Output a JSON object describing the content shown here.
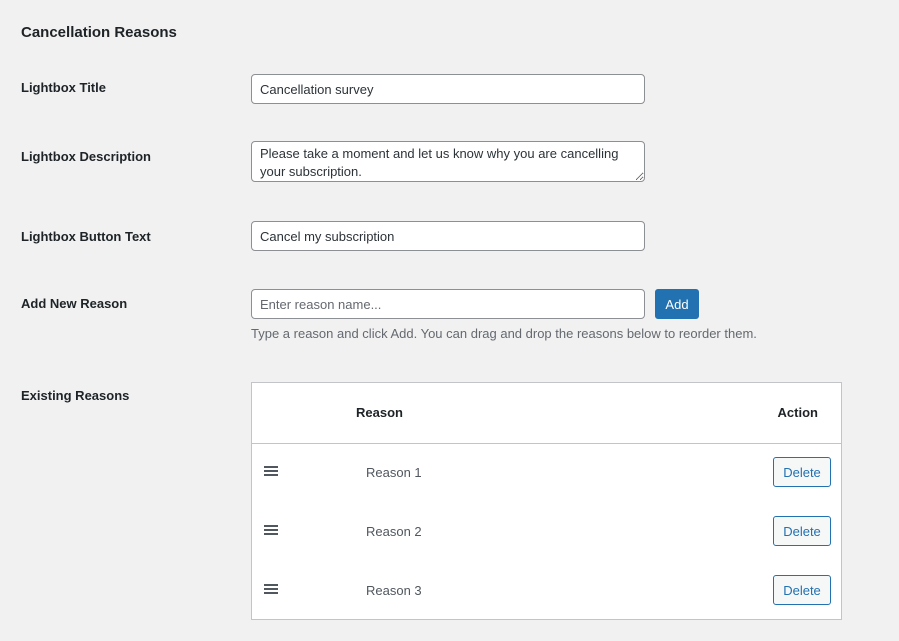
{
  "section": {
    "title": "Cancellation Reasons"
  },
  "fields": {
    "lightbox_title": {
      "label": "Lightbox Title",
      "value": "Cancellation survey"
    },
    "lightbox_description": {
      "label": "Lightbox Description",
      "value": "Please take a moment and let us know why you are cancelling your subscription."
    },
    "lightbox_button_text": {
      "label": "Lightbox Button Text",
      "value": "Cancel my subscription"
    },
    "add_new_reason": {
      "label": "Add New Reason",
      "value": "",
      "placeholder": "Enter reason name...",
      "button_label": "Add",
      "help_text": "Type a reason and click Add. You can drag and drop the reasons below to reorder them."
    },
    "existing_reasons": {
      "label": "Existing Reasons"
    }
  },
  "reasons_table": {
    "columns": {
      "reason": "Reason",
      "action": "Action"
    },
    "rows": [
      {
        "name": "Reason 1",
        "action_label": "Delete"
      },
      {
        "name": "Reason 2",
        "action_label": "Delete"
      },
      {
        "name": "Reason 3",
        "action_label": "Delete"
      }
    ]
  },
  "colors": {
    "accent": "#2271b1",
    "background": "#f1f1f1",
    "border": "#c3c4c7"
  }
}
